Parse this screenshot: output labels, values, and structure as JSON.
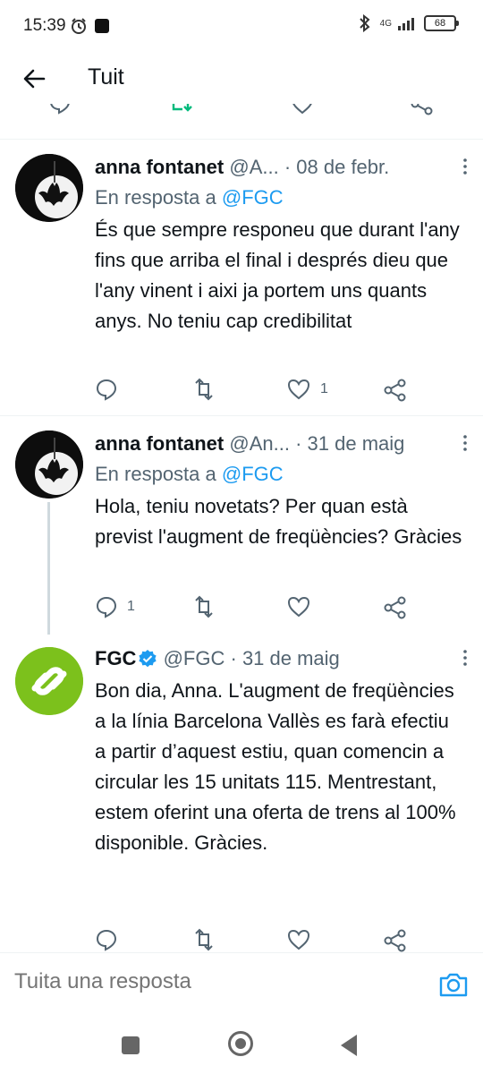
{
  "status_bar": {
    "time": "15:39",
    "network": "4G",
    "battery": "68"
  },
  "header": {
    "title": "Tuit"
  },
  "tweets": [
    {
      "name": "anna fontanet",
      "handle": "@A...",
      "dot": "·",
      "date": "08 de febr.",
      "reply_prefix": "En resposta a",
      "reply_mention": "@FGC",
      "text": "És que sempre responeu que durant l'any fins que arriba el final i després dieu que l'any vinent i aixi ja portem uns quants anys. No teniu cap credibilitat",
      "replies": "",
      "retweets": "",
      "likes": "1"
    },
    {
      "name": "anna fontanet",
      "handle": "@An...",
      "dot": "·",
      "date": "31 de maig",
      "reply_prefix": "En resposta a",
      "reply_mention": "@FGC",
      "text": "Hola, teniu novetats? Per quan està previst l'augment de freqüències? Gràcies",
      "replies": "1",
      "retweets": "",
      "likes": ""
    },
    {
      "name": "FGC",
      "handle": "@FGC",
      "dot": "·",
      "date": "31 de maig",
      "text": "Bon dia, Anna. L'augment de freqüències a la línia Barcelona Vallès es farà efectiu a partir d’aquest estiu, quan comencin a circular les 15 unitats 115. Mentrestant, estem oferint una oferta de trens al 100% disponible. Gràcies.",
      "replies": "",
      "retweets": "",
      "likes": ""
    }
  ],
  "reply_bar": {
    "placeholder": "Tuita una resposta"
  },
  "colors": {
    "accent": "#1d9bf0",
    "muted": "#536471",
    "retweet_green": "#00ba7c",
    "fgc_green": "#7cc11c"
  },
  "icons": [
    "back-arrow-icon",
    "reply-icon",
    "retweet-icon",
    "like-icon",
    "share-icon",
    "more-icon",
    "verified-icon",
    "camera-icon"
  ]
}
